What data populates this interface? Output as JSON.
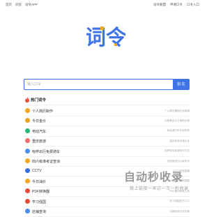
{
  "nav": {
    "left": [
      "首页",
      "问答",
      "词令APP"
    ],
    "right": [
      "词令联盟",
      "申请口令",
      "口令入口"
    ]
  },
  "logo_text": "词令",
  "search": {
    "placeholder": "输入口令",
    "button_label": "前 往"
  },
  "hot": {
    "title": "热门词令",
    "items": [
      {
        "name": "个人简历制作",
        "desc": "个人简历模板在线编辑",
        "color": "#f5a623"
      },
      {
        "name": "今日金价",
        "desc": "中国黄金今日最新价格",
        "color": "#e9a426"
      },
      {
        "name": "电动汽车",
        "desc": "新能源汽车车型推荐",
        "color": "#2bb673"
      },
      {
        "name": "重庆旅游",
        "desc": "重庆旅游攻略大全",
        "color": "#f56c6c"
      },
      {
        "name": "哈啰出行免费骑车",
        "desc": "哈啰单车免费骑行方法",
        "color": "#4a8cf0"
      },
      {
        "name": "四六级准考证查询",
        "desc": "全国英语四六级考试",
        "color": "#f5a623"
      },
      {
        "name": "CCTV",
        "desc": "CCTV央视直播",
        "color": "#3b6fe0"
      },
      {
        "name": "今日油价",
        "desc": "今日油价最新调整",
        "color": "#f5a623"
      },
      {
        "name": "PDF转换器",
        "desc": "PDF格式转换工具",
        "color": "#e84c3d"
      },
      {
        "name": "学习强国",
        "desc": "学习强国官方入口",
        "color": "#e84c3d"
      },
      {
        "name": "店铺查询",
        "desc": "店铺信息在线查询",
        "color": "#4a8cf0"
      }
    ]
  },
  "watermark": {
    "title": "自动秒收录",
    "subtitle": "做上链接一来访一次一秒收录"
  },
  "colors": {
    "accent": "#3e74e8",
    "logo_orange": "#f5a623"
  }
}
